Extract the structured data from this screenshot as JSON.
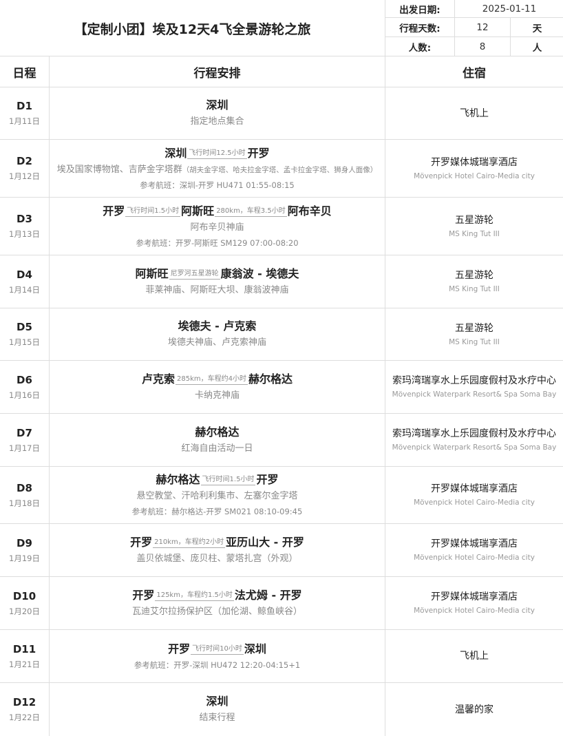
{
  "header": {
    "title": "【定制小团】埃及12天4飞全景游轮之旅",
    "depart_label": "出发日期:",
    "depart_value": "2025-01-11",
    "duration_label": "行程天数:",
    "duration_value": "12",
    "duration_unit": "天",
    "people_label": "人数:",
    "people_value": "8",
    "people_unit": "人"
  },
  "columns": {
    "day": "日程",
    "plan": "行程安排",
    "hotel": "住宿"
  },
  "days": [
    {
      "day": "D1",
      "date": "1月11日",
      "places": [
        "深圳"
      ],
      "segments": [],
      "sights": "指定地点集合",
      "sights_note": "",
      "flight": "",
      "hotel_cn": "飞机上",
      "hotel_en": ""
    },
    {
      "day": "D2",
      "date": "1月12日",
      "places": [
        "深圳",
        "开罗"
      ],
      "segments": [
        "飞行时间12.5小时"
      ],
      "sights": "埃及国家博物馆、吉萨金字塔群",
      "sights_note": "（胡夫金字塔、哈夫拉金字塔、孟卡拉金字塔、狮身人面像）",
      "flight": "参考航班：深圳-开罗 HU471 01:55-08:15",
      "hotel_cn": "开罗媒体城瑞享酒店",
      "hotel_en": "Mövenpick Hotel Cairo-Media city"
    },
    {
      "day": "D3",
      "date": "1月13日",
      "places": [
        "开罗",
        "阿斯旺",
        "阿布辛贝"
      ],
      "segments": [
        "飞行时间1.5小时",
        "280km，车程3.5小时"
      ],
      "sights": "阿布辛贝神庙",
      "sights_note": "",
      "flight": "参考航班：开罗-阿斯旺 SM129 07:00-08:20",
      "hotel_cn": "五星游轮",
      "hotel_en": "MS King Tut III"
    },
    {
      "day": "D4",
      "date": "1月14日",
      "places": [
        "阿斯旺",
        "康翁波 - 埃德夫"
      ],
      "segments": [
        "尼罗河五星游轮"
      ],
      "sights": "菲莱神庙、阿斯旺大坝、康翁波神庙",
      "sights_note": "",
      "flight": "",
      "hotel_cn": "五星游轮",
      "hotel_en": "MS King Tut III"
    },
    {
      "day": "D5",
      "date": "1月15日",
      "places": [
        "埃德夫 - 卢克索"
      ],
      "segments": [],
      "sights": "埃德夫神庙、卢克索神庙",
      "sights_note": "",
      "flight": "",
      "hotel_cn": "五星游轮",
      "hotel_en": "MS King Tut III"
    },
    {
      "day": "D6",
      "date": "1月16日",
      "places": [
        "卢克索",
        "赫尔格达"
      ],
      "segments": [
        "285km，车程约4小时"
      ],
      "sights": "卡纳克神庙",
      "sights_note": "",
      "flight": "",
      "hotel_cn": "索玛湾瑞享水上乐园度假村及水疗中心",
      "hotel_en": "Mövenpick Waterpark Resort& Spa Soma Bay"
    },
    {
      "day": "D7",
      "date": "1月17日",
      "places": [
        "赫尔格达"
      ],
      "segments": [],
      "sights": "红海自由活动一日",
      "sights_note": "",
      "flight": "",
      "hotel_cn": "索玛湾瑞享水上乐园度假村及水疗中心",
      "hotel_en": "Mövenpick Waterpark Resort& Spa Soma Bay"
    },
    {
      "day": "D8",
      "date": "1月18日",
      "places": [
        "赫尔格达",
        "开罗"
      ],
      "segments": [
        "飞行时间1.5小时"
      ],
      "sights": "悬空教堂、汗哈利利集市、左塞尔金字塔",
      "sights_note": "",
      "flight": "参考航班：赫尔格达-开罗 SM021 08:10-09:45",
      "hotel_cn": "开罗媒体城瑞享酒店",
      "hotel_en": "Mövenpick Hotel Cairo-Media city"
    },
    {
      "day": "D9",
      "date": "1月19日",
      "places": [
        "开罗",
        "亚历山大 - 开罗"
      ],
      "segments": [
        "210km，车程约2小时"
      ],
      "sights": "盖贝依城堡、庞贝柱、蒙塔扎宫（外观）",
      "sights_note": "",
      "flight": "",
      "hotel_cn": "开罗媒体城瑞享酒店",
      "hotel_en": "Mövenpick Hotel Cairo-Media city"
    },
    {
      "day": "D10",
      "date": "1月20日",
      "places": [
        "开罗",
        "法尤姆 - 开罗"
      ],
      "segments": [
        "125km，车程约1.5小时"
      ],
      "sights": "瓦迪艾尔拉扬保护区（加伦湖、鲸鱼峡谷）",
      "sights_note": "",
      "flight": "",
      "hotel_cn": "开罗媒体城瑞享酒店",
      "hotel_en": "Mövenpick Hotel Cairo-Media city"
    },
    {
      "day": "D11",
      "date": "1月21日",
      "places": [
        "开罗",
        "深圳"
      ],
      "segments": [
        "飞行时间10小时"
      ],
      "sights": "",
      "sights_note": "",
      "flight": "参考航班：开罗-深圳 HU472 12:20-04:15+1",
      "hotel_cn": "飞机上",
      "hotel_en": ""
    },
    {
      "day": "D12",
      "date": "1月22日",
      "places": [
        "深圳"
      ],
      "segments": [],
      "sights": "结束行程",
      "sights_note": "",
      "flight": "",
      "hotel_cn": "温馨的家",
      "hotel_en": ""
    }
  ]
}
